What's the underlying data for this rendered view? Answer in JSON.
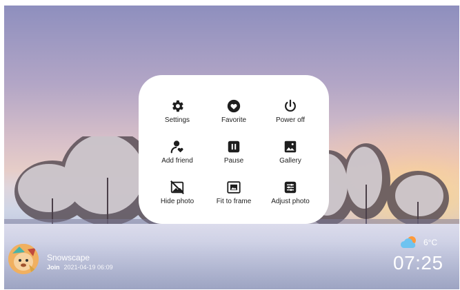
{
  "photo": {
    "title": "Snowscape",
    "join_label": "Join",
    "date": "2021-04-19 06:09"
  },
  "menu": {
    "items": [
      {
        "label": "Settings",
        "icon": "gear-icon"
      },
      {
        "label": "Favorite",
        "icon": "heart-icon"
      },
      {
        "label": "Power off",
        "icon": "power-icon"
      },
      {
        "label": "Add friend",
        "icon": "add-friend-icon"
      },
      {
        "label": "Pause",
        "icon": "pause-icon"
      },
      {
        "label": "Gallery",
        "icon": "gallery-icon"
      },
      {
        "label": "Hide photo",
        "icon": "hide-photo-icon"
      },
      {
        "label": "Fit to frame",
        "icon": "fit-to-frame-icon"
      },
      {
        "label": "Adjust photo",
        "icon": "adjust-icon"
      }
    ]
  },
  "weather": {
    "temperature": "6°C",
    "icon": "cloud-sun-icon"
  },
  "clock": {
    "time": "07:25"
  },
  "colors": {
    "menu_bg": "#ffffff",
    "icon": "#1e1e1e",
    "text_overlay": "#ffffff"
  }
}
